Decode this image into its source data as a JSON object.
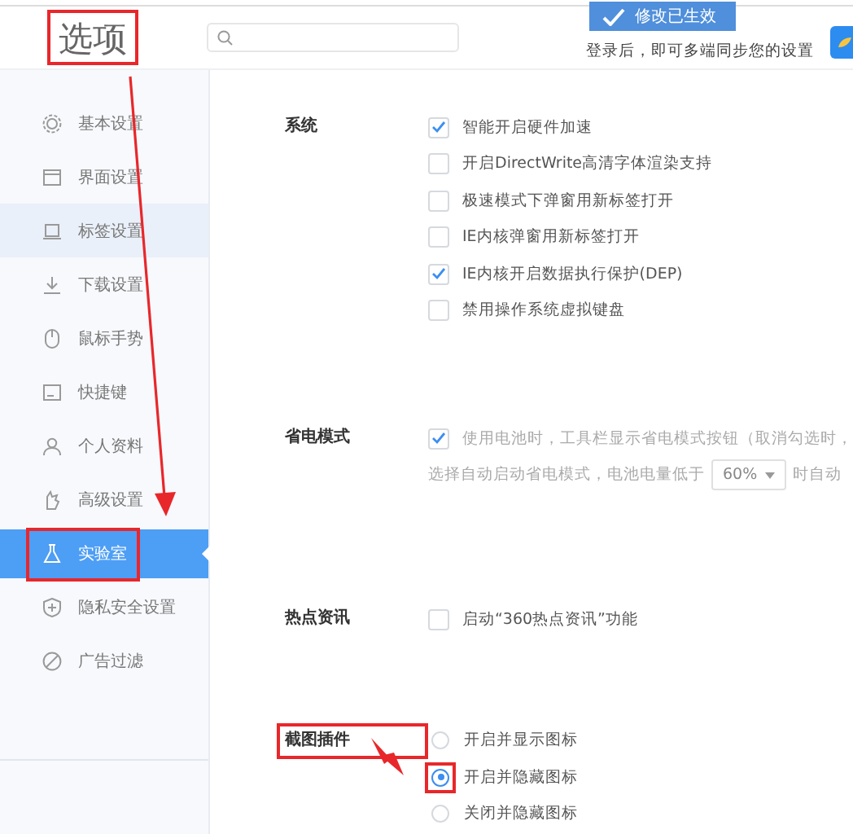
{
  "window": {
    "title": "选项",
    "title_highlighted": true
  },
  "toast": {
    "text": "修改已生效"
  },
  "login_hint": "登录后，即可多端同步您的设置",
  "sidebar": {
    "items": [
      {
        "label": "基本设置",
        "selected": false,
        "hovered": false,
        "highlighted": false
      },
      {
        "label": "界面设置",
        "selected": false,
        "hovered": false,
        "highlighted": false
      },
      {
        "label": "标签设置",
        "selected": false,
        "hovered": true,
        "highlighted": false
      },
      {
        "label": "下载设置",
        "selected": false,
        "hovered": false,
        "highlighted": false
      },
      {
        "label": "鼠标手势",
        "selected": false,
        "hovered": false,
        "highlighted": false
      },
      {
        "label": "快捷键",
        "selected": false,
        "hovered": false,
        "highlighted": false
      },
      {
        "label": "个人资料",
        "selected": false,
        "hovered": false,
        "highlighted": false
      },
      {
        "label": "高级设置",
        "selected": false,
        "hovered": false,
        "highlighted": false
      },
      {
        "label": "实验室",
        "selected": true,
        "hovered": false,
        "highlighted": true
      },
      {
        "label": "隐私安全设置",
        "selected": false,
        "hovered": false,
        "highlighted": false
      },
      {
        "label": "广告过滤",
        "selected": false,
        "hovered": false,
        "highlighted": false
      }
    ]
  },
  "sections": [
    {
      "label": "系统",
      "highlighted": false,
      "options": [
        {
          "kind": "checkbox",
          "label": "智能开启硬件加速",
          "checked": true,
          "disabled": false
        },
        {
          "kind": "checkbox",
          "label": "开启DirectWrite高清字体渲染支持",
          "checked": false,
          "disabled": false
        },
        {
          "kind": "checkbox",
          "label": "极速模式下弹窗用新标签打开",
          "checked": false,
          "disabled": false
        },
        {
          "kind": "checkbox",
          "label": "IE内核弹窗用新标签打开",
          "checked": false,
          "disabled": false
        },
        {
          "kind": "checkbox",
          "label": "IE内核开启数据执行保护(DEP)",
          "checked": true,
          "disabled": false
        },
        {
          "kind": "checkbox",
          "label": "禁用操作系统虚拟键盘",
          "checked": false,
          "disabled": false
        }
      ]
    },
    {
      "label": "省电模式",
      "highlighted": false,
      "options": [
        {
          "kind": "checkbox",
          "label": "使用电池时，工具栏显示省电模式按钮（取消勾选时，",
          "checked": true,
          "disabled": true
        },
        {
          "kind": "select",
          "text_before": "选择自动启动省电模式，电池电量低于",
          "value": "60%",
          "text_after": "时自动",
          "disabled": true
        }
      ]
    },
    {
      "label": "热点资讯",
      "highlighted": false,
      "options": [
        {
          "kind": "checkbox",
          "label": "启动“360热点资讯”功能",
          "checked": false,
          "disabled": false
        }
      ]
    },
    {
      "label": "截图插件",
      "highlighted": true,
      "options": [
        {
          "kind": "radio",
          "label": "开启并显示图标",
          "selected": false,
          "highlighted": false
        },
        {
          "kind": "radio",
          "label": "开启并隐藏图标",
          "selected": true,
          "highlighted": true
        },
        {
          "kind": "radio",
          "label": "关闭并隐藏图标",
          "selected": false,
          "highlighted": false
        }
      ]
    }
  ]
}
